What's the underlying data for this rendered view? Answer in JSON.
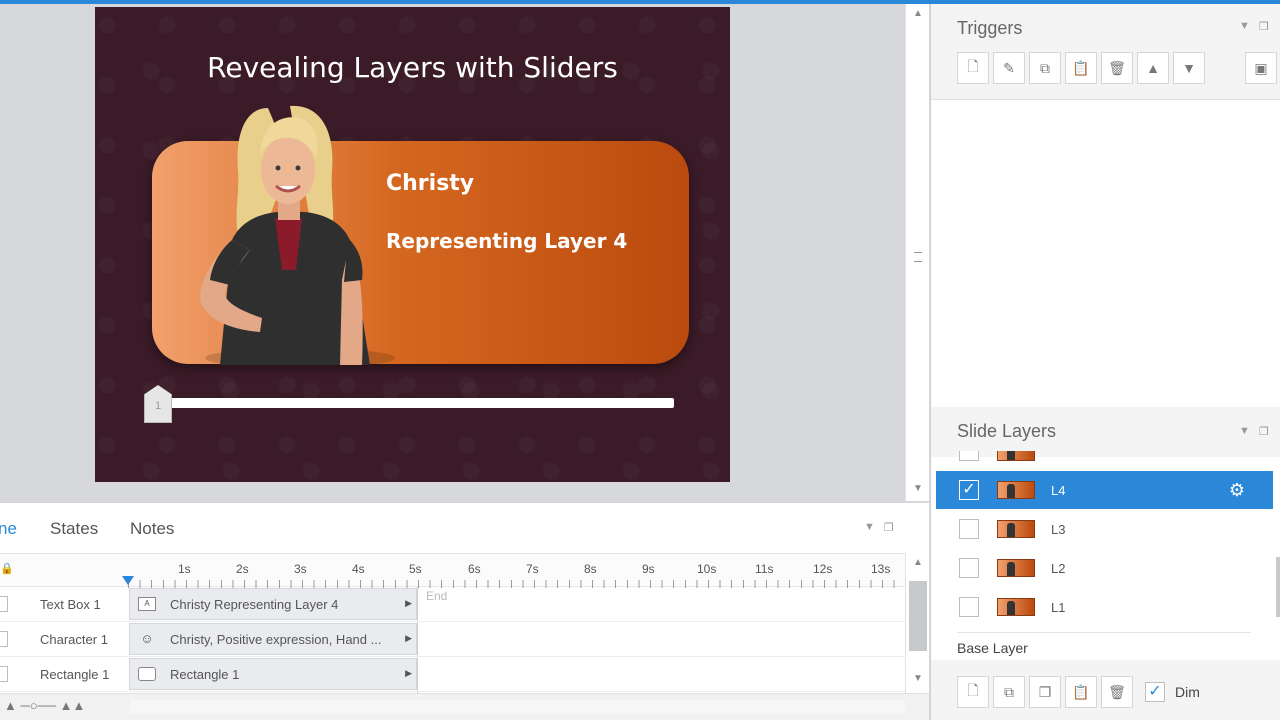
{
  "slide": {
    "title": "Revealing Layers with Sliders",
    "name": "Christy",
    "layer_text": "Representing Layer 4",
    "slider_value": "1",
    "colors": {
      "background": "#3a1b27",
      "card": "#c65818"
    }
  },
  "triggers": {
    "title": "Triggers",
    "toolbar": [
      "new-trigger-icon",
      "edit-trigger-icon",
      "copy-icon",
      "paste-icon",
      "delete-icon",
      "move-up-icon",
      "move-down-icon",
      "trigger-settings-icon"
    ]
  },
  "layers": {
    "title": "Slide Layers",
    "items": [
      {
        "label": "L4",
        "checked": "✓",
        "selected": true
      },
      {
        "label": "L3",
        "checked": "",
        "selected": false
      },
      {
        "label": "L2",
        "checked": "",
        "selected": false
      },
      {
        "label": "L1",
        "checked": "",
        "selected": false
      }
    ],
    "base_layer": "Base Layer",
    "dim_label": "Dim",
    "dim_checked": "✓"
  },
  "timeline": {
    "tabs": [
      "ne",
      "States",
      "Notes"
    ],
    "ticks": [
      "1s",
      "2s",
      "3s",
      "4s",
      "5s",
      "6s",
      "7s",
      "8s",
      "9s",
      "10s",
      "11s",
      "12s",
      "13s"
    ],
    "end_label": "End",
    "rows": [
      {
        "label": "Text Box 1",
        "bar_text": "Christy  Representing Layer 4",
        "icon": "text-box-icon"
      },
      {
        "label": "Character 1",
        "bar_text": "Christy, Positive expression, Hand ...",
        "icon": "character-icon"
      },
      {
        "label": "Rectangle 1",
        "bar_text": "Rectangle 1",
        "icon": "rectangle-icon"
      }
    ]
  }
}
